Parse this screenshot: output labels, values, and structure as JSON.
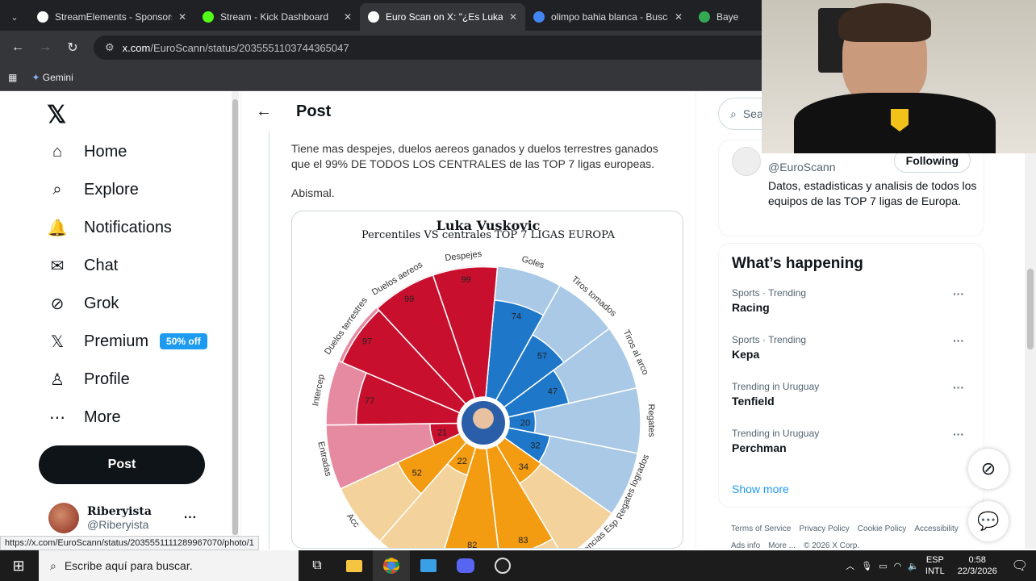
{
  "browser": {
    "tabs": [
      {
        "title": "StreamElements - Sponsorsh",
        "icon": "streamelements-icon",
        "color": "#ffffff"
      },
      {
        "title": "Stream - Kick Dashboard",
        "icon": "kick-icon",
        "color": "#53fc18"
      },
      {
        "title": "Euro Scan on X: \"¿Es Luka V",
        "icon": "x-icon",
        "color": "#ffffff"
      },
      {
        "title": "olimpo bahia blanca - Busca",
        "icon": "google-icon",
        "color": "#4285f4"
      },
      {
        "title": "Bayern M",
        "icon": "globe-icon",
        "color": "#34a853"
      }
    ],
    "url_host": "x.com",
    "url_path": "/EuroScann/status/2035551103744365047",
    "bookmark": "Gemini",
    "status_url": "https://x.com/EuroScann/status/2035551111289967070/photo/1"
  },
  "nav": {
    "items": [
      {
        "label": "Home",
        "icon": "home-icon"
      },
      {
        "label": "Explore",
        "icon": "search-icon"
      },
      {
        "label": "Notifications",
        "icon": "bell-icon"
      },
      {
        "label": "Chat",
        "icon": "mail-icon"
      },
      {
        "label": "Grok",
        "icon": "grok-icon"
      },
      {
        "label": "Premium",
        "icon": "x-icon"
      },
      {
        "label": "Profile",
        "icon": "person-icon"
      },
      {
        "label": "More",
        "icon": "more-icon"
      }
    ],
    "premium_badge": "50% off",
    "post_button": "Post",
    "account_name": "Riberyista",
    "account_handle": "@Riberyista"
  },
  "post": {
    "header": "Post",
    "text": "Tiene mas despejes, duelos aereos ganados y duelos terrestres ganados que el 99% DE TODOS LOS CENTRALES de las TOP 7 ligas europeas.",
    "text2": "Abismal."
  },
  "chart_data": {
    "type": "radial-bar",
    "title": "Luka Vuskovic",
    "subtitle": "Percentiles VS centrales TOP 7 LIGAS EUROPA",
    "categories": [
      "Goles",
      "Tiros tomados",
      "Tiros al arco",
      "Regates",
      "Regates logrados",
      "Asistencias Esp",
      "",
      "",
      "",
      "Acc",
      "Entradas",
      "Intercep",
      "Duelos terrestres",
      "Duelos aereos",
      "Despejes"
    ],
    "values": [
      74,
      57,
      47,
      20,
      32,
      34,
      83,
      82,
      22,
      52,
      21,
      77,
      97,
      99,
      99
    ],
    "groups": [
      "attack",
      "attack",
      "attack",
      "attack",
      "attack",
      "possession",
      "possession",
      "possession",
      "possession",
      "possession",
      "defense",
      "defense",
      "defense",
      "defense",
      "defense"
    ],
    "colors": {
      "attack": "#1f77c9",
      "attack_bg": "#a9c9e6",
      "possession": "#f39c12",
      "possession_bg": "#f3d29b",
      "defense": "#c8102e",
      "defense_bg": "#e58aa0"
    }
  },
  "right": {
    "search_placeholder": "Sea",
    "profile_handle": "@EuroScann",
    "profile_button": "Following",
    "profile_bio": "Datos, estadisticas y analisis de todos los equipos de las TOP 7 ligas de Europa.",
    "happening_title": "What’s happening",
    "trends": [
      {
        "category": "Sports · Trending",
        "name": "Racing"
      },
      {
        "category": "Sports · Trending",
        "name": "Kepa"
      },
      {
        "category": "Trending in Uruguay",
        "name": "Tenfield"
      },
      {
        "category": "Trending in Uruguay",
        "name": "Perchman"
      }
    ],
    "show_more": "Show more",
    "footer": [
      "Terms of Service",
      "Privacy Policy",
      "Cookie Policy",
      "Accessibility",
      "Ads info",
      "More ...",
      "© 2026 X Corp."
    ]
  },
  "taskbar": {
    "search_placeholder": "Escribe aquí para buscar.",
    "lang1": "ESP",
    "lang2": "INTL",
    "time": "0:58",
    "date": "22/3/2026"
  }
}
